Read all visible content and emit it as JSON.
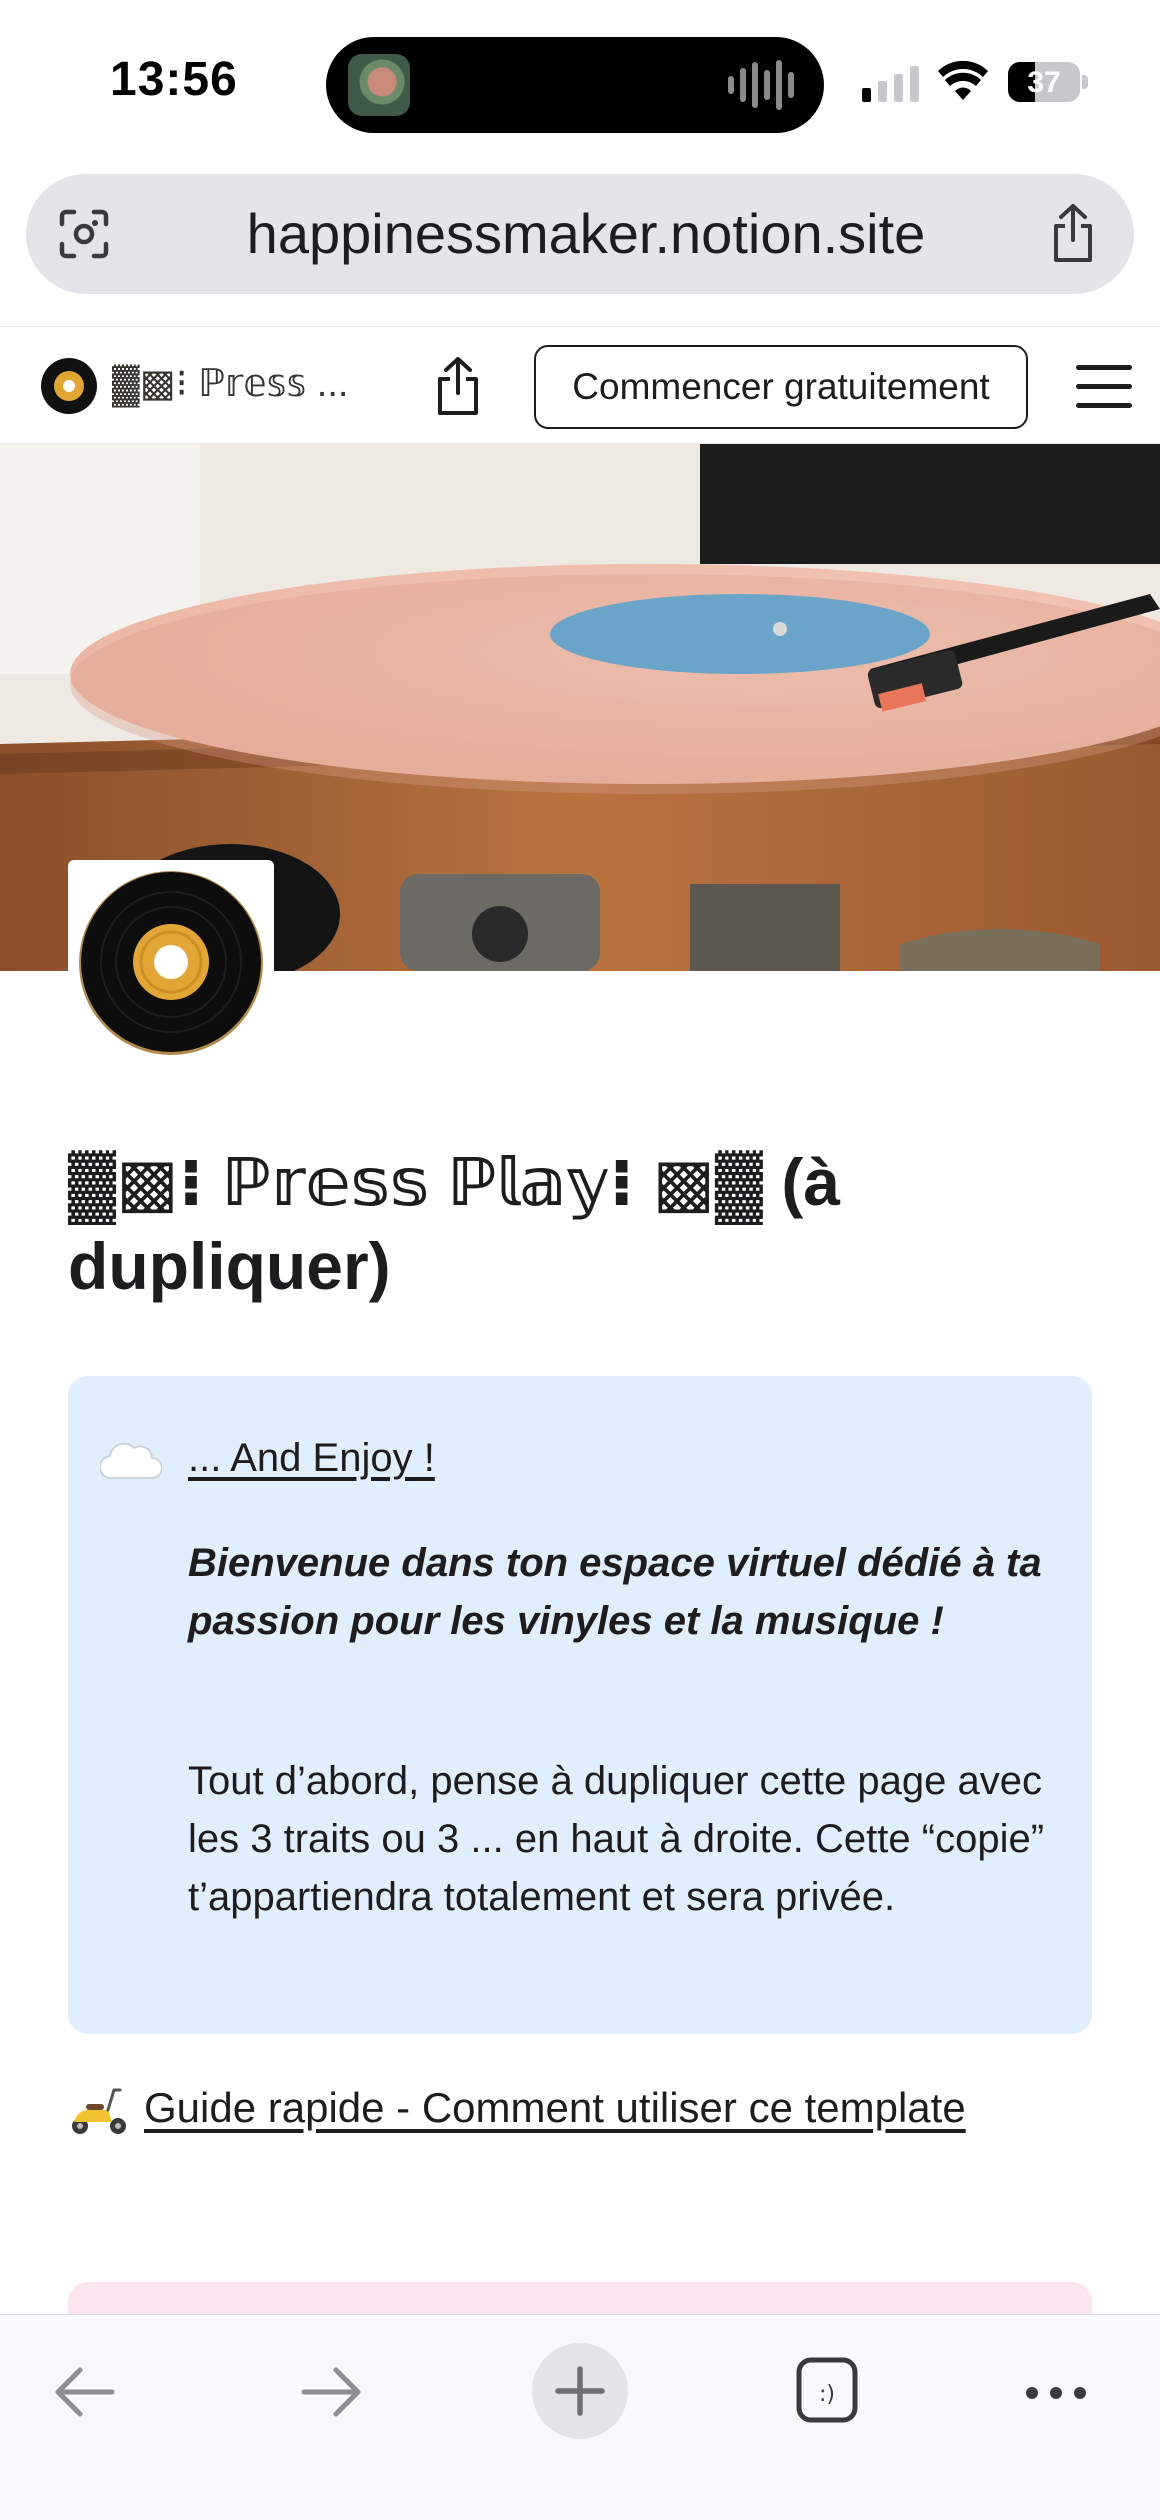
{
  "status_bar": {
    "time": "13:56",
    "battery_level": "37",
    "signal_bars_active": 1,
    "icons": [
      "cellular-signal-icon",
      "wifi-icon",
      "battery-icon"
    ]
  },
  "browser": {
    "url": "happinessmaker.notion.site",
    "icons": [
      "visual-lookup-icon",
      "share-icon"
    ]
  },
  "notion_header": {
    "title": "▓▩⁝ ℙ𝕣𝕖𝕤𝕤 ...",
    "start_button": "Commencer gratuitement",
    "icons": [
      "vinyl-logo-icon",
      "share-icon",
      "hamburger-menu-icon"
    ]
  },
  "page": {
    "title": "▓▩⁝ ℙ𝕣𝕖𝕤𝕤 ℙ𝕝𝕒𝕪⁝ ▩▓ (à dupliquer)",
    "cover_description_icon": "turntable-cover-image",
    "page_icon": "vinyl-record-icon",
    "callout": {
      "emoji": "cloud-icon",
      "link_text": "... And Enjoy !",
      "bold_text": "Bienvenue dans ton espace virtuel dédié à ta passion pour les vinyles et la musique !",
      "body_text": "Tout d’abord, pense à dupliquer cette page avec les 3 traits ou 3 ... en haut à droite. Cette “copie” t’appartiendra totalement et sera privée.",
      "background": "#e1eefb"
    },
    "guide_link": {
      "emoji": "scooter-icon",
      "text": "Guide rapide - Comment utiliser ce template"
    },
    "next_block_color": "#fde5f0"
  },
  "toolbar": {
    "icons": [
      "back-arrow-icon",
      "forward-arrow-icon",
      "new-tab-plus-icon",
      "tabs-icon",
      "more-dots-icon"
    ],
    "tabs_glyph": ":)"
  }
}
